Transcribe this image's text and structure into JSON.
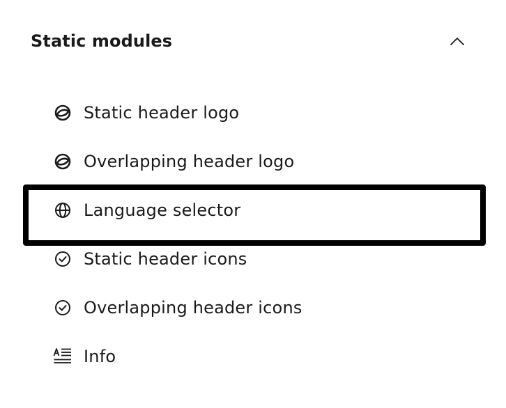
{
  "section": {
    "title": "Static modules",
    "expanded": true
  },
  "items": [
    {
      "label": "Static header logo",
      "icon": "logo-icon"
    },
    {
      "label": "Overlapping header logo",
      "icon": "logo-icon"
    },
    {
      "label": "Language selector",
      "icon": "globe-icon",
      "highlighted": true
    },
    {
      "label": "Static header icons",
      "icon": "check-circle-icon"
    },
    {
      "label": "Overlapping header icons",
      "icon": "check-circle-icon"
    },
    {
      "label": "Info",
      "icon": "text-info-icon"
    }
  ],
  "colors": {
    "text": "#1a1a1a",
    "highlight_border": "#000000",
    "background": "#ffffff"
  }
}
